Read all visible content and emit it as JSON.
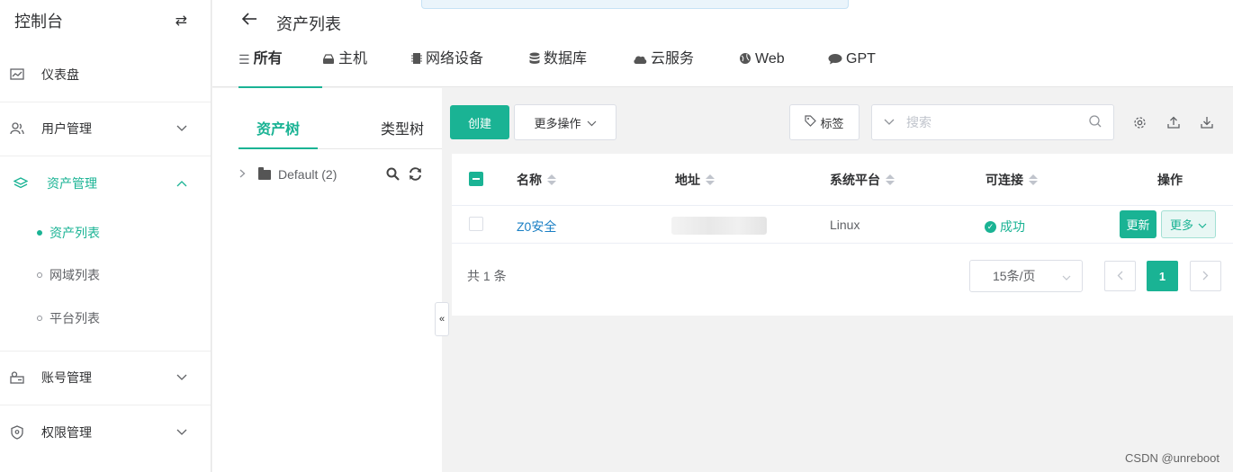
{
  "sidebar": {
    "title": "控制台",
    "items": [
      {
        "label": "仪表盘",
        "icon": "dashboard-icon"
      },
      {
        "label": "用户管理",
        "icon": "users-icon"
      },
      {
        "label": "资产管理",
        "icon": "layers-icon"
      },
      {
        "label": "账号管理",
        "icon": "account-icon"
      },
      {
        "label": "权限管理",
        "icon": "shield-icon"
      }
    ],
    "subitems": [
      {
        "label": "资产列表"
      },
      {
        "label": "网域列表"
      },
      {
        "label": "平台列表"
      }
    ]
  },
  "header": {
    "title": "资产列表",
    "tabs": [
      {
        "label": "所有"
      },
      {
        "label": "主机"
      },
      {
        "label": "网络设备"
      },
      {
        "label": "数据库"
      },
      {
        "label": "云服务"
      },
      {
        "label": "Web"
      },
      {
        "label": "GPT"
      }
    ]
  },
  "tree": {
    "tabs": [
      {
        "label": "资产树"
      },
      {
        "label": "类型树"
      }
    ],
    "node": "Default (2)"
  },
  "toolbar": {
    "create": "创建",
    "more": "更多操作",
    "tag": "标签",
    "search_placeholder": "搜索"
  },
  "table": {
    "columns": [
      "名称",
      "地址",
      "系统平台",
      "可连接",
      "操作"
    ],
    "rows": [
      {
        "name": "Z0安全",
        "platform": "Linux",
        "status": "成功"
      }
    ],
    "update": "更新",
    "more": "更多"
  },
  "pagination": {
    "total": "共 1 条",
    "pagesize": "15条/页",
    "current": "1"
  },
  "watermark": "CSDN @unreboot",
  "colors": {
    "accent": "#1ab394",
    "link": "#1a7fc4"
  }
}
